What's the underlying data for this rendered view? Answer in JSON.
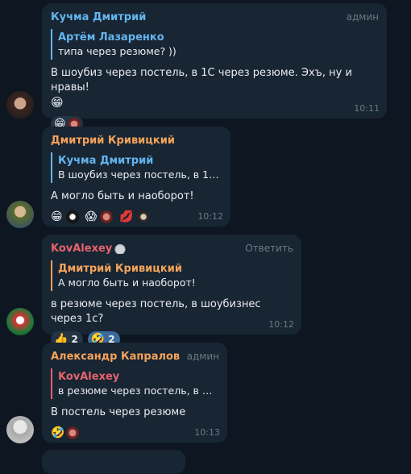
{
  "messages": [
    {
      "author": "Кучма Дмитрий",
      "author_color": "#64b5ef",
      "role": "админ",
      "quote": {
        "author": "Артём Лазаренко",
        "text": "типа через резюме? ))",
        "color": "#64b5ef"
      },
      "text": "В шоубиз через постель, в 1С через резюме. Эхъ, ну и нравы!",
      "emoji": "😁",
      "reactions": [
        "😁",
        "avatar-chip"
      ],
      "time": "10:11"
    },
    {
      "author": "Дмитрий Кривицкий",
      "author_color": "#f5a35b",
      "quote": {
        "author": "Кучма Дмитрий",
        "text": "В шоубиз через постель, в 1С ...",
        "color": "#64b5ef"
      },
      "text": "А могло быть и наоборот!",
      "reactions": [
        "😁",
        "🐼",
        "😱",
        "avatar-chip",
        "💋",
        "avatar-chip"
      ],
      "time": "10:12"
    },
    {
      "author": "KovAlexey",
      "author_color": "#e5636d",
      "reply_label": "Ответить",
      "quote": {
        "author": "Дмитрий Кривицкий",
        "text": "А могло быть и наоборот!",
        "color": "#f5a35b"
      },
      "text": "в резюме через постель, в шоубизнес через 1с?",
      "reactions": [
        {
          "emoji": "👍",
          "count": "2"
        },
        {
          "emoji": "🤣",
          "count": "2"
        }
      ],
      "time": "10:12"
    },
    {
      "author": "Александр Капралов",
      "author_color": "#f5a35b",
      "role": "админ",
      "quote": {
        "author": "KovAlexey",
        "text": "в резюме через постель, в шоу...",
        "color": "#e5636d"
      },
      "text": "В постель через резюме",
      "reactions": [
        "🤣",
        "avatar-chip"
      ],
      "time": "10:13"
    }
  ]
}
